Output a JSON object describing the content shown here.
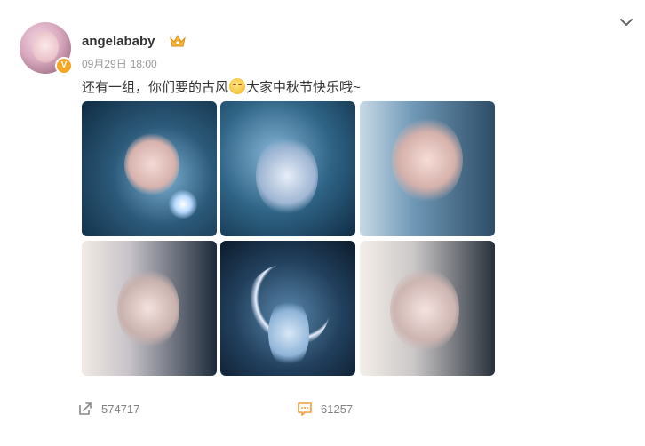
{
  "post": {
    "username": "angelababy",
    "badge_letter": "V",
    "date": "09月29日",
    "time": "18:00",
    "text_before_emoji": "还有一组，你们要的古风",
    "text_after_emoji": "大家中秋节快乐哦~"
  },
  "images": [
    {
      "id": 1
    },
    {
      "id": 2
    },
    {
      "id": 3
    },
    {
      "id": 4
    },
    {
      "id": 5
    },
    {
      "id": 6
    }
  ],
  "actions": {
    "repost_count": "574717",
    "comment_count": "61257"
  },
  "colors": {
    "text": "#333333",
    "meta": "#999999",
    "accent_orange": "#f5a623"
  },
  "icons": {
    "more": "chevron-down-icon",
    "member": "crown-icon",
    "emoji": "smile-emoji-icon",
    "repost": "share-icon",
    "comment": "comment-icon"
  }
}
